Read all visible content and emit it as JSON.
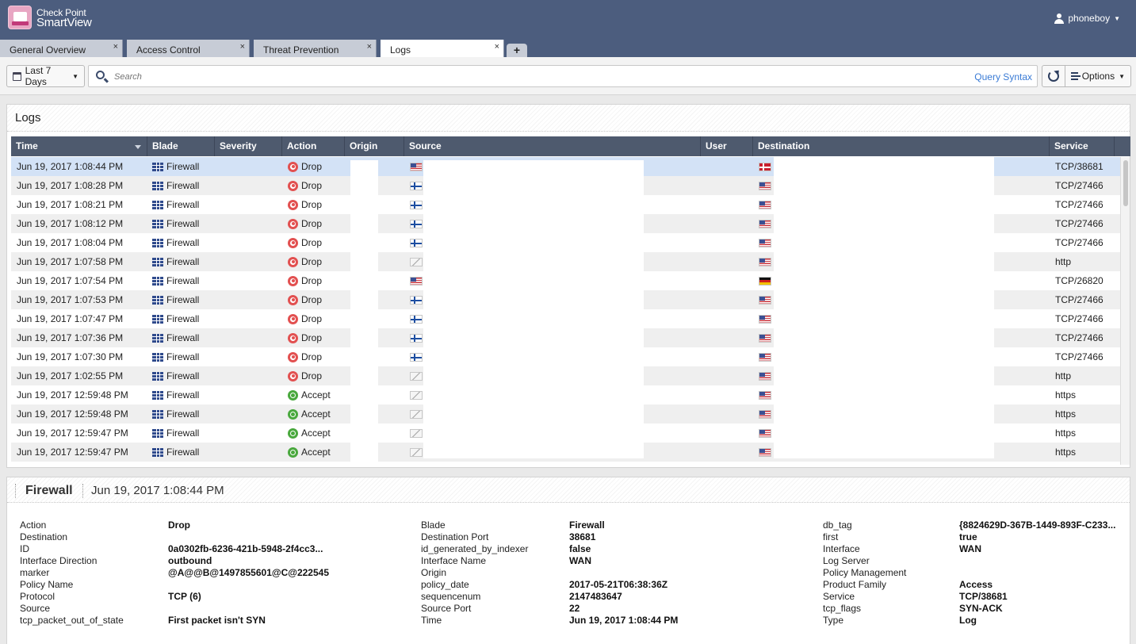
{
  "app": {
    "brand_line1": "Check Point",
    "brand_line2": "SmartView",
    "user": "phoneboy"
  },
  "tabs": [
    {
      "label": "General Overview",
      "close": "×"
    },
    {
      "label": "Access Control",
      "close": "×"
    },
    {
      "label": "Threat Prevention",
      "close": "×"
    },
    {
      "label": "Logs",
      "close": "×"
    }
  ],
  "tab_add": "+",
  "toolbar": {
    "time_filter": "Last 7 Days",
    "search_placeholder": "Search",
    "query_syntax": "Query Syntax",
    "options": "Options"
  },
  "logs": {
    "title": "Logs",
    "columns": [
      "Time",
      "Blade",
      "Severity",
      "Action",
      "Origin",
      "Source",
      "User",
      "Destination",
      "Service"
    ],
    "rows": [
      {
        "time": "Jun 19, 2017 1:08:44 PM",
        "blade": "Firewall",
        "action": "Drop",
        "src_flag": "us",
        "dst_flag": "dk",
        "service": "TCP/38681",
        "selected": true
      },
      {
        "time": "Jun 19, 2017 1:08:28 PM",
        "blade": "Firewall",
        "action": "Drop",
        "src_flag": "fi",
        "dst_flag": "us",
        "service": "TCP/27466"
      },
      {
        "time": "Jun 19, 2017 1:08:21 PM",
        "blade": "Firewall",
        "action": "Drop",
        "src_flag": "fi",
        "dst_flag": "us",
        "service": "TCP/27466"
      },
      {
        "time": "Jun 19, 2017 1:08:12 PM",
        "blade": "Firewall",
        "action": "Drop",
        "src_flag": "fi",
        "dst_flag": "us",
        "service": "TCP/27466"
      },
      {
        "time": "Jun 19, 2017 1:08:04 PM",
        "blade": "Firewall",
        "action": "Drop",
        "src_flag": "fi",
        "dst_flag": "us",
        "service": "TCP/27466"
      },
      {
        "time": "Jun 19, 2017 1:07:58 PM",
        "blade": "Firewall",
        "action": "Drop",
        "src_flag": "unk",
        "dst_flag": "us",
        "service": "http"
      },
      {
        "time": "Jun 19, 2017 1:07:54 PM",
        "blade": "Firewall",
        "action": "Drop",
        "src_flag": "us",
        "dst_flag": "de",
        "service": "TCP/26820"
      },
      {
        "time": "Jun 19, 2017 1:07:53 PM",
        "blade": "Firewall",
        "action": "Drop",
        "src_flag": "fi",
        "dst_flag": "us",
        "service": "TCP/27466"
      },
      {
        "time": "Jun 19, 2017 1:07:47 PM",
        "blade": "Firewall",
        "action": "Drop",
        "src_flag": "fi",
        "dst_flag": "us",
        "service": "TCP/27466"
      },
      {
        "time": "Jun 19, 2017 1:07:36 PM",
        "blade": "Firewall",
        "action": "Drop",
        "src_flag": "fi",
        "dst_flag": "us",
        "service": "TCP/27466"
      },
      {
        "time": "Jun 19, 2017 1:07:30 PM",
        "blade": "Firewall",
        "action": "Drop",
        "src_flag": "fi",
        "dst_flag": "us",
        "service": "TCP/27466"
      },
      {
        "time": "Jun 19, 2017 1:02:55 PM",
        "blade": "Firewall",
        "action": "Drop",
        "src_flag": "unk",
        "dst_flag": "us",
        "service": "http"
      },
      {
        "time": "Jun 19, 2017 12:59:48 PM",
        "blade": "Firewall",
        "action": "Accept",
        "src_flag": "unk",
        "dst_flag": "us",
        "service": "https"
      },
      {
        "time": "Jun 19, 2017 12:59:48 PM",
        "blade": "Firewall",
        "action": "Accept",
        "src_flag": "unk",
        "dst_flag": "us",
        "service": "https"
      },
      {
        "time": "Jun 19, 2017 12:59:47 PM",
        "blade": "Firewall",
        "action": "Accept",
        "src_flag": "unk",
        "dst_flag": "us",
        "service": "https"
      },
      {
        "time": "Jun 19, 2017 12:59:47 PM",
        "blade": "Firewall",
        "action": "Accept",
        "src_flag": "unk",
        "dst_flag": "us",
        "service": "https"
      }
    ]
  },
  "details": {
    "blade": "Firewall",
    "time": "Jun 19, 2017 1:08:44 PM",
    "col1": [
      {
        "k": "Action",
        "v": "Drop"
      },
      {
        "k": "Destination",
        "v": ""
      },
      {
        "k": "ID",
        "v": "0a0302fb-6236-421b-5948-2f4cc3..."
      },
      {
        "k": "Interface Direction",
        "v": "outbound"
      },
      {
        "k": "marker",
        "v": "@A@@B@1497855601@C@222545"
      },
      {
        "k": "Policy Name",
        "v": ""
      },
      {
        "k": "Protocol",
        "v": "TCP (6)"
      },
      {
        "k": "Source",
        "v": ""
      },
      {
        "k": "tcp_packet_out_of_state",
        "v": "First packet isn't SYN"
      }
    ],
    "col2": [
      {
        "k": "Blade",
        "v": "Firewall"
      },
      {
        "k": "Destination Port",
        "v": "38681"
      },
      {
        "k": "id_generated_by_indexer",
        "v": "false"
      },
      {
        "k": "Interface Name",
        "v": "WAN"
      },
      {
        "k": "Origin",
        "v": ""
      },
      {
        "k": "policy_date",
        "v": "2017-05-21T06:38:36Z"
      },
      {
        "k": "sequencenum",
        "v": "2147483647"
      },
      {
        "k": "Source Port",
        "v": "22"
      },
      {
        "k": "Time",
        "v": "Jun 19, 2017 1:08:44 PM"
      }
    ],
    "col3": [
      {
        "k": "db_tag",
        "v": "{8824629D-367B-1449-893F-C233..."
      },
      {
        "k": "first",
        "v": "true"
      },
      {
        "k": "Interface",
        "v": "WAN"
      },
      {
        "k": "Log Server",
        "v": ""
      },
      {
        "k": "Policy Management",
        "v": ""
      },
      {
        "k": "Product Family",
        "v": "Access"
      },
      {
        "k": "Service",
        "v": "TCP/38681"
      },
      {
        "k": "tcp_flags",
        "v": "SYN-ACK"
      },
      {
        "k": "Type",
        "v": "Log"
      }
    ]
  }
}
